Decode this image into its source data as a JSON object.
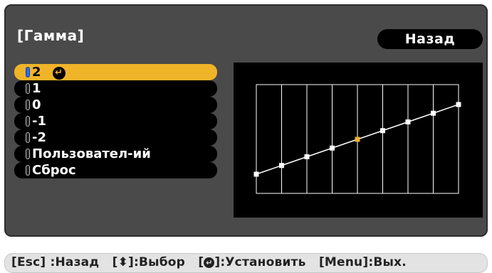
{
  "title": "[Гамма]",
  "back_label": "Назад",
  "options": [
    {
      "label": "2",
      "selected": true
    },
    {
      "label": "1",
      "selected": false
    },
    {
      "label": "0",
      "selected": false
    },
    {
      "label": "-1",
      "selected": false
    },
    {
      "label": "-2",
      "selected": false
    },
    {
      "label": "Пользовател-ий",
      "selected": false
    },
    {
      "label": "Сброс",
      "selected": false
    }
  ],
  "gamma_curve": {
    "points": [
      0,
      1,
      2,
      3,
      4,
      5,
      6,
      7,
      8
    ],
    "highlight_index": 4,
    "colors": {
      "line": "#ffffff",
      "point": "#ffffff",
      "highlight": "#f0b429",
      "grid": "#ffffff"
    }
  },
  "footer": {
    "esc": "[Esc] :Назад",
    "select": "[⬍]:Выбор",
    "set_prefix": "[",
    "set_suffix": "]:Установить",
    "menu": "[Menu]:Вых."
  },
  "colors": {
    "accent": "#f0b429",
    "panel": "#4a4a4a"
  }
}
